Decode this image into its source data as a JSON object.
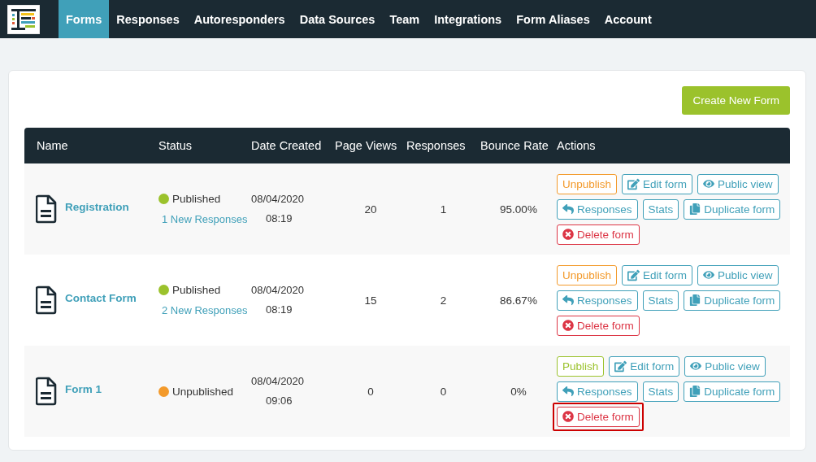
{
  "nav": {
    "items": [
      {
        "label": "Forms",
        "selected": true
      },
      {
        "label": "Responses",
        "selected": false
      },
      {
        "label": "Autoresponders",
        "selected": false
      },
      {
        "label": "Data Sources",
        "selected": false
      },
      {
        "label": "Team",
        "selected": false
      },
      {
        "label": "Integrations",
        "selected": false
      },
      {
        "label": "Form Aliases",
        "selected": false
      },
      {
        "label": "Account",
        "selected": false
      }
    ]
  },
  "create_button": "Create New Form",
  "table": {
    "columns": [
      "Name",
      "Status",
      "Date Created",
      "Page Views",
      "Responses",
      "Bounce Rate",
      "Actions"
    ],
    "rows": [
      {
        "name": "Registration",
        "status": {
          "label": "Published",
          "color": "#9bc22c"
        },
        "new_responses": "1 New Responses",
        "date": "08/04/2020",
        "time": "08:19",
        "page_views": "20",
        "responses": "1",
        "bounce_rate": "95.00%",
        "actions": [
          {
            "kind": "unpublish",
            "label": "Unpublish"
          },
          {
            "kind": "edit",
            "label": "Edit form"
          },
          {
            "kind": "view",
            "label": "Public view"
          },
          {
            "kind": "responses",
            "label": "Responses"
          },
          {
            "kind": "stats",
            "label": "Stats"
          },
          {
            "kind": "duplicate",
            "label": "Duplicate form"
          },
          {
            "kind": "delete",
            "label": "Delete form",
            "highlighted": false
          }
        ]
      },
      {
        "name": "Contact Form",
        "status": {
          "label": "Published",
          "color": "#9bc22c"
        },
        "new_responses": "2 New Responses",
        "date": "08/04/2020",
        "time": "08:19",
        "page_views": "15",
        "responses": "2",
        "bounce_rate": "86.67%",
        "actions": [
          {
            "kind": "unpublish",
            "label": "Unpublish"
          },
          {
            "kind": "edit",
            "label": "Edit form"
          },
          {
            "kind": "view",
            "label": "Public view"
          },
          {
            "kind": "responses",
            "label": "Responses"
          },
          {
            "kind": "stats",
            "label": "Stats"
          },
          {
            "kind": "duplicate",
            "label": "Duplicate form"
          },
          {
            "kind": "delete",
            "label": "Delete form",
            "highlighted": false
          }
        ]
      },
      {
        "name": "Form 1",
        "status": {
          "label": "Unpublished",
          "color": "#f39a2b"
        },
        "date": "08/04/2020",
        "time": "09:06",
        "page_views": "0",
        "responses": "0",
        "bounce_rate": "0%",
        "actions": [
          {
            "kind": "publish",
            "label": "Publish"
          },
          {
            "kind": "edit",
            "label": "Edit form"
          },
          {
            "kind": "view",
            "label": "Public view"
          },
          {
            "kind": "responses",
            "label": "Responses"
          },
          {
            "kind": "stats",
            "label": "Stats"
          },
          {
            "kind": "duplicate",
            "label": "Duplicate form"
          },
          {
            "kind": "delete",
            "label": "Delete form",
            "highlighted": true
          }
        ]
      }
    ]
  }
}
